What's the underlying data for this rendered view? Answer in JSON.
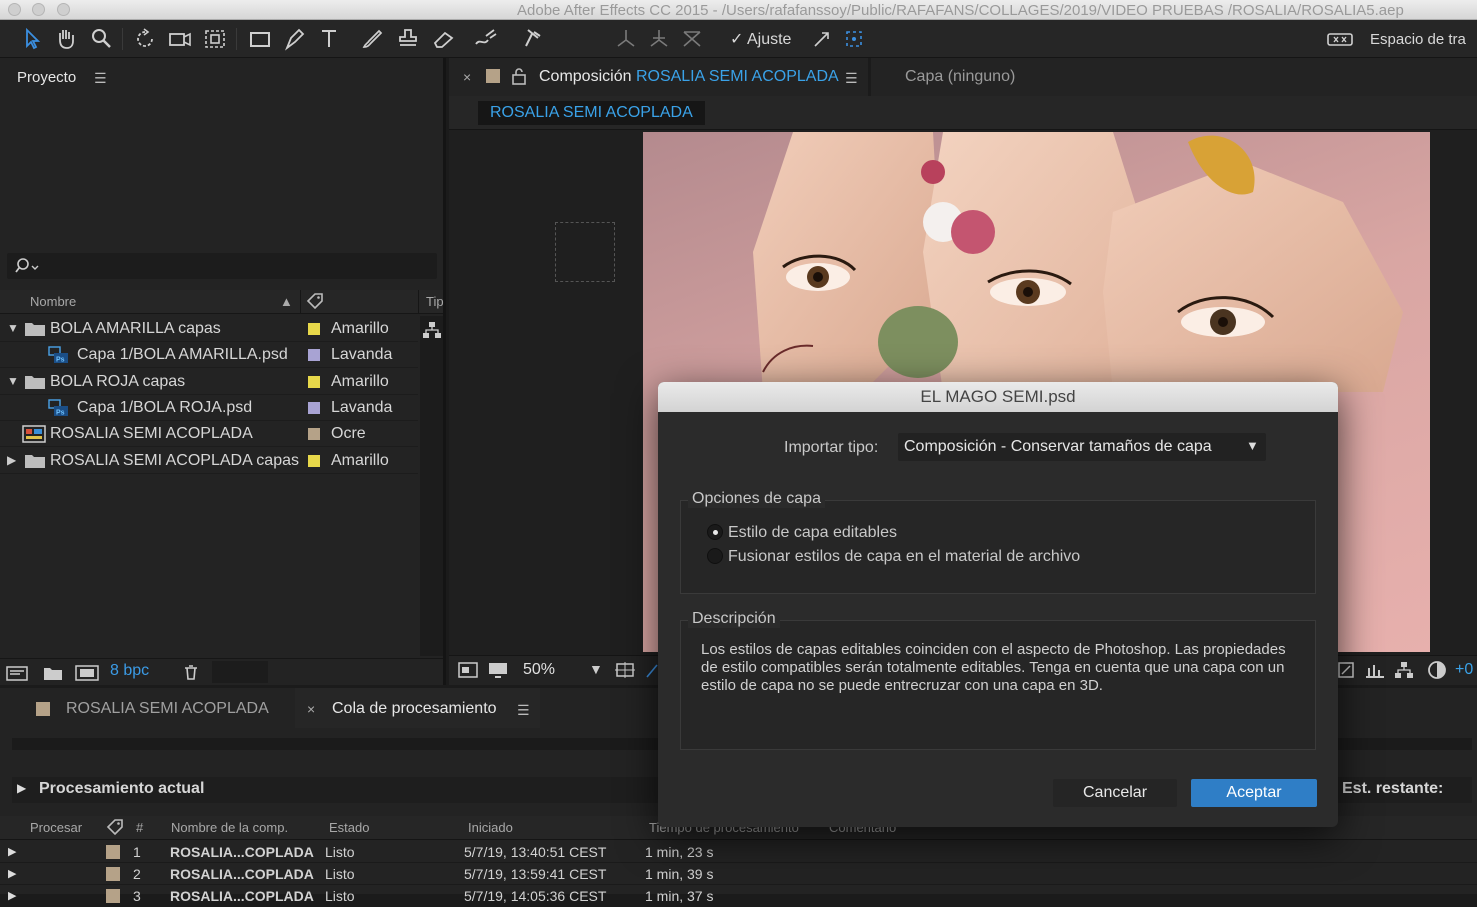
{
  "window": {
    "title": "Adobe After Effects CC 2015 - /Users/rafafanssoy/Public/RAFAFANS/COLLAGES/2019/VIDEO PRUEBAS /ROSALIA/ROSALIA5.aep"
  },
  "toolbar": {
    "snap_label": "Ajuste",
    "workspace_label": "Espacio de tra"
  },
  "project": {
    "title": "Proyecto",
    "search_placeholder": "",
    "columns": {
      "name": "Nombre",
      "type": "Tip"
    },
    "items": [
      {
        "name": "BOLA AMARILLA capas",
        "label": "Amarillo",
        "color": "#e7d84a",
        "kind": "folder",
        "expanded": true
      },
      {
        "name": "Capa 1/BOLA AMARILLA.psd",
        "label": "Lavanda",
        "color": "#a8a3d3",
        "kind": "psd"
      },
      {
        "name": "BOLA ROJA capas",
        "label": "Amarillo",
        "color": "#e7d84a",
        "kind": "folder",
        "expanded": true
      },
      {
        "name": "Capa 1/BOLA ROJA.psd",
        "label": "Lavanda",
        "color": "#a8a3d3",
        "kind": "psd"
      },
      {
        "name": "ROSALIA SEMI ACOPLADA",
        "label": "Ocre",
        "color": "#b5a288",
        "kind": "comp"
      },
      {
        "name": "ROSALIA SEMI ACOPLADA capas",
        "label": "Amarillo",
        "color": "#e7d84a",
        "kind": "folder",
        "expanded": false
      }
    ],
    "bpc": "8 bpc"
  },
  "composition": {
    "tab_prefix": "Composición",
    "tab_name": "ROSALIA SEMI ACOPLADA",
    "layer_tab": "Capa (ninguno)",
    "breadcrumb": "ROSALIA SEMI ACOPLADA",
    "zoom": "50%",
    "offset": "+0"
  },
  "bottom": {
    "tab_comp": "ROSALIA SEMI ACOPLADA",
    "tab_queue": "Cola de procesamiento",
    "current": "Procesamiento actual",
    "remaining": "Est. restante:",
    "columns": {
      "render": "Procesar",
      "num": "#",
      "comp": "Nombre de la comp.",
      "status": "Estado",
      "started": "Iniciado",
      "time": "Tiempo de procesamiento",
      "comment": "Comentario"
    },
    "rows": [
      {
        "num": "1",
        "comp": "ROSALIA...COPLADA",
        "status": "Listo",
        "started": "5/7/19, 13:40:51 CEST",
        "time": "1 min, 23 s"
      },
      {
        "num": "2",
        "comp": "ROSALIA...COPLADA",
        "status": "Listo",
        "started": "5/7/19, 13:59:41 CEST",
        "time": "1 min, 39 s"
      },
      {
        "num": "3",
        "comp": "ROSALIA...COPLADA",
        "status": "Listo",
        "started": "5/7/19, 14:05:36 CEST",
        "time": "1 min, 37 s"
      }
    ],
    "accent": "#b5a288"
  },
  "dialog": {
    "title": "EL MAGO SEMI.psd",
    "import_label": "Importar tipo:",
    "import_value": "Composición - Conservar tamaños de capa",
    "layer_options": "Opciones de capa",
    "option1": "Estilo de capa editables",
    "option2": "Fusionar estilos de capa en el material de archivo",
    "selected_option": 1,
    "description_label": "Descripción",
    "description": "Los estilos de capas editables coinciden con el aspecto de Photoshop. Las propiedades de estilo compatibles serán totalmente editables. Tenga en cuenta que una capa con un estilo de capa no se puede entrecruzar con una capa en 3D.",
    "cancel": "Cancelar",
    "ok": "Aceptar",
    "accent": "#2f7ec6"
  }
}
